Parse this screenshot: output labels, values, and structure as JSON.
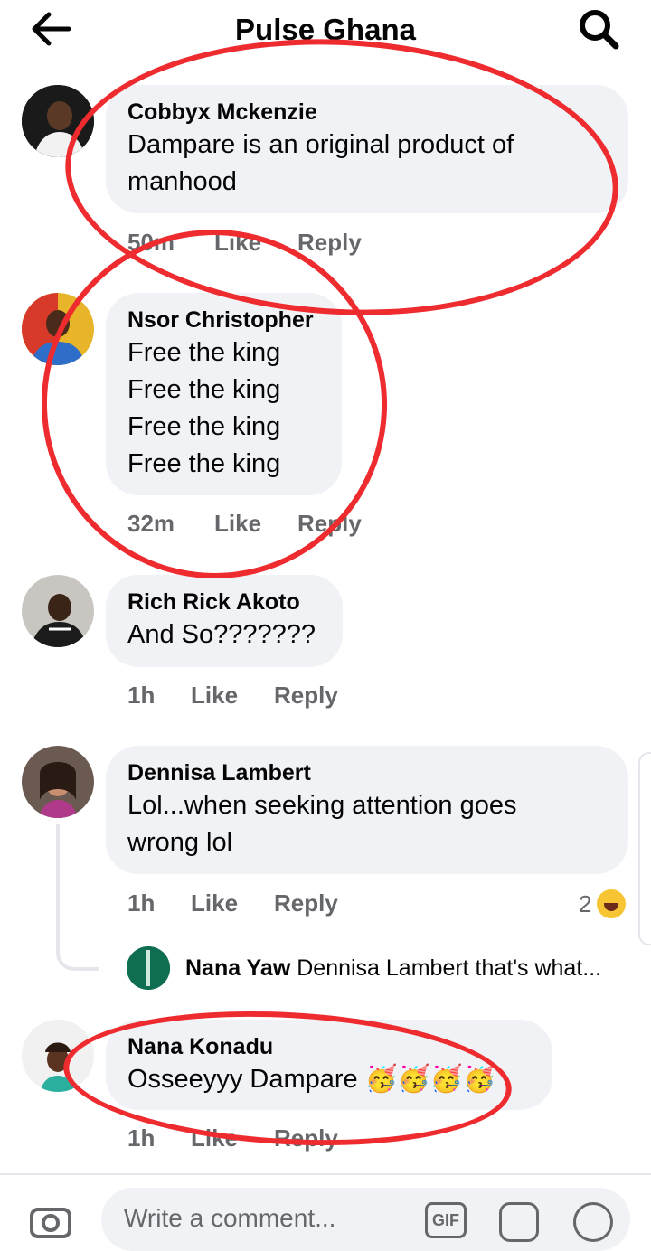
{
  "header": {
    "title": "Pulse Ghana",
    "back_icon": "arrow-left-icon",
    "search_icon": "magnifier-icon"
  },
  "comments": [
    {
      "author": "Cobbyx Mckenzie",
      "text": "Dampare is an original product of\nmanhood",
      "time": "50m",
      "like": "Like",
      "reply": "Reply"
    },
    {
      "author": "Nsor Christopher",
      "text": "Free the king\nFree the king\nFree the king\nFree the king",
      "time": "32m",
      "like": "Like",
      "reply": "Reply"
    },
    {
      "author": "Rich Rick Akoto",
      "text": "And So???????",
      "time": "1h",
      "like": "Like",
      "reply": "Reply"
    },
    {
      "author": "Dennisa Lambert",
      "text": "Lol...when seeking attention goes\nwrong lol",
      "time": "1h",
      "like": "Like",
      "reply": "Reply",
      "reaction_count": "2",
      "reaction_icon": "laughing-face-icon"
    },
    {
      "author": "Nana Konadu",
      "text": "Osseeyyy Dampare 🥳🥳🥳🥳",
      "time": "1h",
      "like": "Like",
      "reply": "Reply"
    }
  ],
  "nested_reply": {
    "author": "Nana Yaw",
    "text": "Dennisa Lambert that's what..."
  },
  "composer": {
    "placeholder": "Write a comment...",
    "gif_label": "GIF",
    "camera_icon": "camera-icon",
    "sticker_icon": "sticker-icon",
    "emoji_icon": "emoji-icon"
  },
  "colors": {
    "bubble": "#f0f2f5",
    "meta": "#65676b",
    "annotation_ring": "#ee2b2f"
  }
}
